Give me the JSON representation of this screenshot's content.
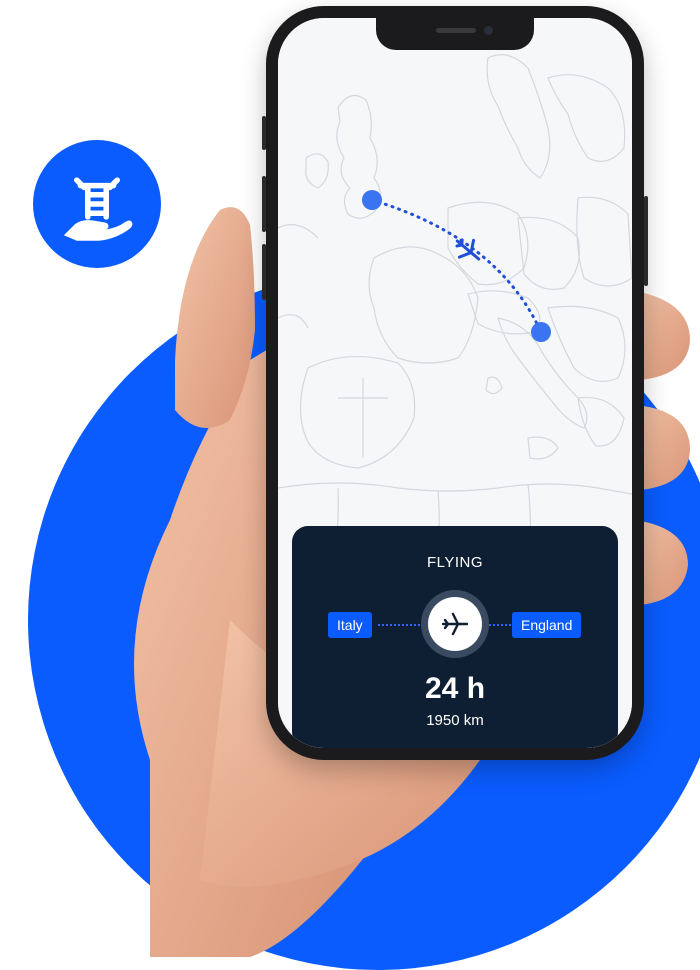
{
  "colors": {
    "brand_blue": "#0a5cff",
    "card_navy": "#0f1f33",
    "route_blue": "#2b66ff"
  },
  "badge": {
    "icon": "hand-holding-ladder-icon"
  },
  "flight_card": {
    "status": "FLYING",
    "origin": "Italy",
    "destination": "England",
    "duration": "24 h",
    "distance": "1950 km",
    "icon": "airplane-icon"
  },
  "map": {
    "markers": [
      "origin-marker",
      "destination-marker"
    ],
    "route_icon": "airplane-icon"
  }
}
